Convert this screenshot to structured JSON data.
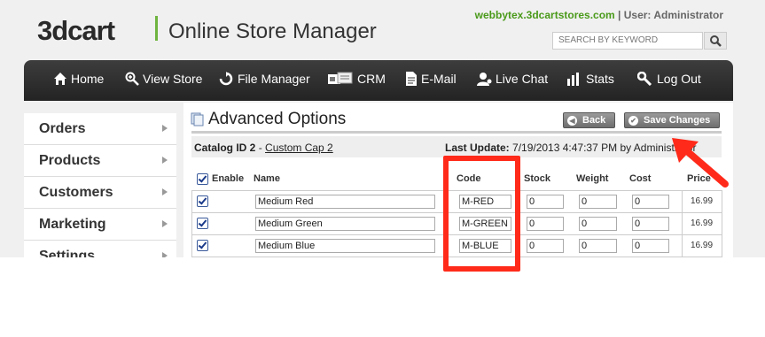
{
  "header": {
    "logo": "3dcart",
    "subtitle": "Online Store Manager",
    "site": "webbytex.3dcartstores.com",
    "separator": " | ",
    "user_label": "User: Administrator",
    "search_placeholder": "SEARCH BY KEYWORD"
  },
  "nav": [
    {
      "label": "Home",
      "icon": "home-icon"
    },
    {
      "label": "View Store",
      "icon": "magnifier-icon"
    },
    {
      "label": "File Manager",
      "icon": "refresh-icon"
    },
    {
      "label": "CRM",
      "icon": "cards-icon"
    },
    {
      "label": "E-Mail",
      "icon": "document-icon"
    },
    {
      "label": "Live Chat",
      "icon": "user-icon"
    },
    {
      "label": "Stats",
      "icon": "bar-chart-icon"
    },
    {
      "label": "Log Out",
      "icon": "wrench-icon"
    }
  ],
  "sidebar": {
    "items": [
      {
        "label": "Orders"
      },
      {
        "label": "Products"
      },
      {
        "label": "Customers"
      },
      {
        "label": "Marketing"
      },
      {
        "label": "Settings"
      }
    ]
  },
  "page": {
    "title": "Advanced Options",
    "back_label": "Back",
    "save_label": "Save Changes",
    "catalog_label": "Catalog ID 2",
    "catalog_sep": " - ",
    "catalog_name": "Custom Cap 2",
    "update_label": "Last Update:",
    "update_value": " 7/19/2013 4:47:37 PM by Administrator"
  },
  "table": {
    "headers": {
      "enable": "Enable",
      "name": "Name",
      "code": "Code",
      "stock": "Stock",
      "weight": "Weight",
      "cost": "Cost",
      "price": "Price"
    },
    "rows": [
      {
        "name": "Medium Red",
        "code": "M-RED",
        "stock": "0",
        "weight": "0",
        "cost": "0",
        "price": "16.99"
      },
      {
        "name": "Medium Green",
        "code": "M-GREEN",
        "stock": "0",
        "weight": "0",
        "cost": "0",
        "price": "16.99"
      },
      {
        "name": "Medium Blue",
        "code": "M-BLUE",
        "stock": "0",
        "weight": "0",
        "cost": "0",
        "price": "16.99"
      }
    ]
  },
  "colors": {
    "accent": "#6fb43f",
    "site_link": "#4a9a1a",
    "annotation": "#ff2a1a",
    "nav_bg": "#2e2e2e"
  }
}
